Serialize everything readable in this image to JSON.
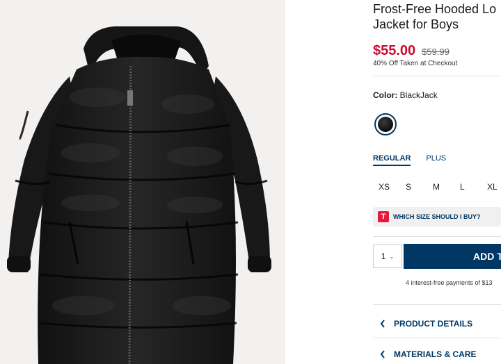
{
  "product": {
    "title": "Frost-Free Hooded Lo\nJacket for Boys",
    "sale_price": "$55.00",
    "original_price": "$59.99",
    "discount_note": "40% Off Taken at Checkout",
    "color_label": "Color:",
    "color_value": "BlackJack"
  },
  "fit_tabs": [
    {
      "label": "REGULAR",
      "active": true
    },
    {
      "label": "PLUS",
      "active": false
    }
  ],
  "sizes": [
    "XS",
    "S",
    "M",
    "L",
    "XL"
  ],
  "size_help": {
    "badge": "T",
    "label": "WHICH SIZE SHOULD I BUY?"
  },
  "cart": {
    "quantity": "1",
    "add_label": "ADD T"
  },
  "installment_text": "4 interest-free payments of $13",
  "accordions": [
    {
      "label": "PRODUCT DETAILS"
    },
    {
      "label": "MATERIALS & CARE"
    }
  ],
  "colors": {
    "accent": "#003764",
    "sale": "#cc0b2f",
    "badge": "#e31c3d"
  }
}
